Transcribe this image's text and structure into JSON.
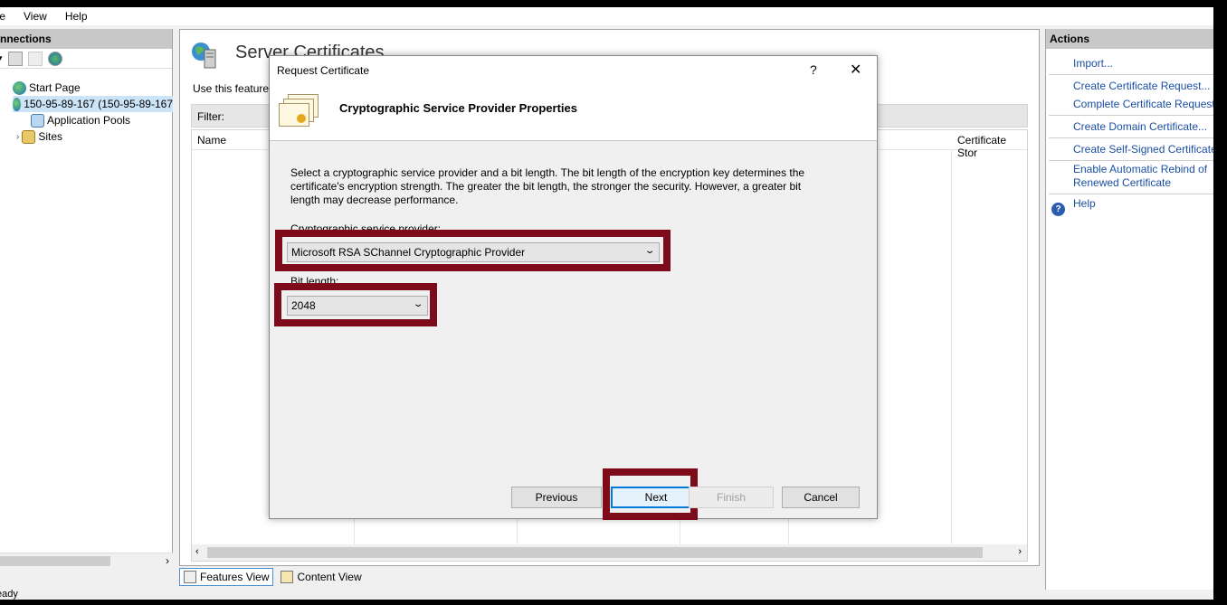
{
  "menu": {
    "items": [
      "ile",
      "View",
      "Help"
    ]
  },
  "connections": {
    "header": "nnections",
    "tree": [
      {
        "label": "Start Page"
      },
      {
        "label": "150-95-89-167 (150-95-89-167"
      },
      {
        "label": "Application Pools"
      },
      {
        "label": "Sites"
      }
    ]
  },
  "main": {
    "title": "Server Certificates",
    "description": "Use this feature t",
    "filter_label": "Filter:",
    "columns": [
      "Name",
      "Certificate Stor"
    ]
  },
  "view_tabs": {
    "features": "Features View",
    "content": "Content View"
  },
  "actions": {
    "header": "Actions",
    "items": [
      "Import...",
      "Create Certificate Request...",
      "Complete Certificate Request",
      "Create Domain Certificate...",
      "Create Self-Signed Certificate",
      "Enable Automatic Rebind of",
      "Renewed Certificate",
      "Help"
    ]
  },
  "status": {
    "text": "eady"
  },
  "dialog": {
    "title": "Request Certificate",
    "help_glyph": "?",
    "close_glyph": "✕",
    "heading": "Cryptographic Service Provider Properties",
    "description": "Select a cryptographic service provider and a bit length. The bit length of the encryption key determines the certificate's encryption strength. The greater the bit length, the stronger the security. However, a greater bit length may decrease performance.",
    "provider_label": "Cryptographic service provider:",
    "provider_value": "Microsoft RSA SChannel Cryptographic Provider",
    "bitlength_label": "Bit length:",
    "bitlength_value": "2048",
    "buttons": {
      "previous": "Previous",
      "next": "Next",
      "finish": "Finish",
      "cancel": "Cancel"
    }
  },
  "colors": {
    "highlight": "#7d0b1a",
    "link": "#1a4fa3",
    "focus": "#0078d7"
  }
}
